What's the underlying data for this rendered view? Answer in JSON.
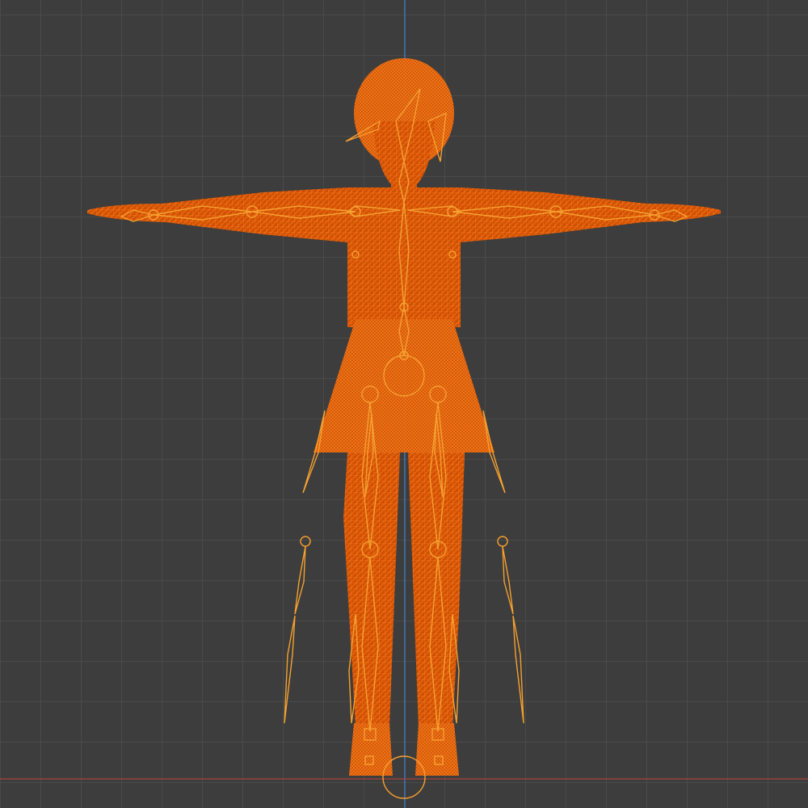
{
  "viewport": {
    "grid_visible": true,
    "axes": {
      "z_axis_color": "#3f7fd6",
      "x_axis_color": "#b8463a"
    }
  },
  "model": {
    "mesh_icon": "wireframe-mesh-icon",
    "armature_icon": "armature-bone-icon",
    "wire_color": "#ff6a00",
    "fill_color": "#e55a00",
    "bone_color": "#f5a030",
    "selected": true
  }
}
